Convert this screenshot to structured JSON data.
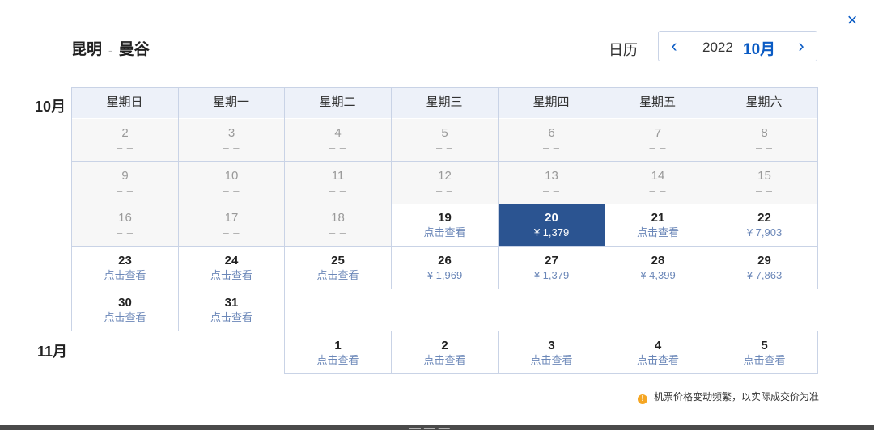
{
  "route": {
    "from": "昆明",
    "sep": "-",
    "to": "曼谷"
  },
  "calendar_label": "日历",
  "picker": {
    "year": "2022",
    "month": "10月",
    "prev": "‹",
    "next": "›"
  },
  "close": "×",
  "weekdays": [
    "星期日",
    "星期一",
    "星期二",
    "星期三",
    "星期四",
    "星期五",
    "星期六"
  ],
  "months": [
    {
      "label": "10月",
      "days": [
        {
          "d": "2",
          "p": "– –",
          "state": "past"
        },
        {
          "d": "3",
          "p": "– –",
          "state": "past"
        },
        {
          "d": "4",
          "p": "– –",
          "state": "past"
        },
        {
          "d": "5",
          "p": "– –",
          "state": "past"
        },
        {
          "d": "6",
          "p": "– –",
          "state": "past"
        },
        {
          "d": "7",
          "p": "– –",
          "state": "past"
        },
        {
          "d": "8",
          "p": "– –",
          "state": "past"
        },
        {
          "d": "9",
          "p": "– –",
          "state": "past"
        },
        {
          "d": "10",
          "p": "– –",
          "state": "past"
        },
        {
          "d": "11",
          "p": "– –",
          "state": "past"
        },
        {
          "d": "12",
          "p": "– –",
          "state": "past"
        },
        {
          "d": "13",
          "p": "– –",
          "state": "past"
        },
        {
          "d": "14",
          "p": "– –",
          "state": "past"
        },
        {
          "d": "15",
          "p": "– –",
          "state": "past"
        },
        {
          "d": "16",
          "p": "– –",
          "state": "past"
        },
        {
          "d": "17",
          "p": "– –",
          "state": "past"
        },
        {
          "d": "18",
          "p": "– –",
          "state": "past"
        },
        {
          "d": "19",
          "p": "点击查看",
          "state": "normal"
        },
        {
          "d": "20",
          "p": "¥ 1,379",
          "state": "selected"
        },
        {
          "d": "21",
          "p": "点击查看",
          "state": "normal"
        },
        {
          "d": "22",
          "p": "¥ 7,903",
          "state": "normal"
        },
        {
          "d": "23",
          "p": "点击查看",
          "state": "normal"
        },
        {
          "d": "24",
          "p": "点击查看",
          "state": "normal"
        },
        {
          "d": "25",
          "p": "点击查看",
          "state": "normal"
        },
        {
          "d": "26",
          "p": "¥ 1,969",
          "state": "normal"
        },
        {
          "d": "27",
          "p": "¥ 1,379",
          "state": "normal"
        },
        {
          "d": "28",
          "p": "¥ 4,399",
          "state": "normal"
        },
        {
          "d": "29",
          "p": "¥ 7,863",
          "state": "normal"
        },
        {
          "d": "30",
          "p": "点击查看",
          "state": "normal"
        },
        {
          "d": "31",
          "p": "点击查看",
          "state": "normal"
        }
      ]
    },
    {
      "label": "11月",
      "days": [
        {
          "d": "1",
          "p": "点击查看",
          "state": "normal"
        },
        {
          "d": "2",
          "p": "点击查看",
          "state": "normal"
        },
        {
          "d": "3",
          "p": "点击查看",
          "state": "normal"
        },
        {
          "d": "4",
          "p": "点击查看",
          "state": "normal"
        },
        {
          "d": "5",
          "p": "点击查看",
          "state": "normal"
        }
      ]
    }
  ],
  "note": "机票价格变动频繁，以实际成交价为准",
  "colors": {
    "accent": "#0a5bc4",
    "selected": "#2b5491",
    "header_bg": "#edf1f9",
    "price": "#6b87b8",
    "warning": "#f5a623"
  }
}
